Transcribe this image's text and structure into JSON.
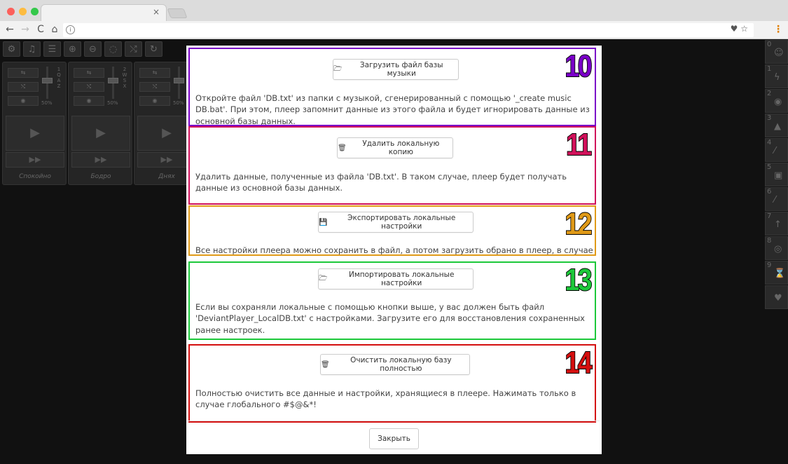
{
  "browser": {
    "traffic_lights": [
      "#fc605b",
      "#fdbc40",
      "#34c84a"
    ],
    "tab_close": "×",
    "nav_back": "←",
    "nav_forward": "→",
    "nav_reload": "C",
    "nav_home": "⌂",
    "info": "i",
    "omni_icons": "♥ ☆",
    "menu": "⋮"
  },
  "player": {
    "tools": [
      "gear-icon",
      "music-icon",
      "database-icon",
      "zoom-in-icon",
      "zoom-out-icon",
      "hide-icon",
      "shuffle-icon",
      "refresh-icon"
    ],
    "tool_glyphs": [
      "⚙",
      "♫",
      "☰",
      "⊕",
      "⊖",
      "◌",
      "⤭",
      "↻"
    ],
    "channels": [
      {
        "name": "Спокойно",
        "keys": "1 Q A Z",
        "volume": "50%"
      },
      {
        "name": "Бодро",
        "keys": "2 W S X",
        "volume": "50%"
      },
      {
        "name": "Днях",
        "keys": "",
        "volume": "50%"
      }
    ],
    "channel_btn_glyphs": [
      "⇆",
      "⤭",
      "◉"
    ],
    "play_glyph": "▶",
    "ff_glyph": "▶▶",
    "right_bar": [
      {
        "num": "0",
        "icon": "smile-icon",
        "glyph": "☺"
      },
      {
        "num": "1",
        "icon": "lightning-icon",
        "glyph": "ϟ"
      },
      {
        "num": "2",
        "icon": "eye-icon",
        "glyph": "◉"
      },
      {
        "num": "3",
        "icon": "warning-icon",
        "glyph": "▲"
      },
      {
        "num": "4",
        "icon": "magic-icon",
        "glyph": "⁄"
      },
      {
        "num": "5",
        "icon": "money-icon",
        "glyph": "▣"
      },
      {
        "num": "6",
        "icon": "feather-icon",
        "glyph": "⁄"
      },
      {
        "num": "7",
        "icon": "level-up-icon",
        "glyph": "↑"
      },
      {
        "num": "8",
        "icon": "record-icon",
        "glyph": "◎"
      },
      {
        "num": "9",
        "icon": "hourglass-icon",
        "glyph": "⌛"
      },
      {
        "num": "",
        "icon": "heartbeat-icon",
        "glyph": "♥"
      }
    ]
  },
  "modal": {
    "sections": [
      {
        "number": "10",
        "color": "#7a00c8",
        "button_label": "Загрузить файл базы музыки",
        "button_glyph": "🗁",
        "description": "Откройте файл 'DB.txt' из папки с музыкой, сгенерированный с помощью '_create music DB.bat'. При этом, плеер запомнит данные из этого файла и будет игнорировать данные из основной базы данных."
      },
      {
        "number": "11",
        "color": "#d0105a",
        "button_label": "Удалить локальную копию",
        "button_glyph": "🗑",
        "description": "Удалить данные, полученные из файла 'DB.txt'. В таком случае, плеер будет получать данные из основной базы данных."
      },
      {
        "number": "12",
        "color": "#e09a18",
        "button_label": "Экспортировать локальные настройки",
        "button_glyph": "💾",
        "description": "Все настройки плеера можно сохранить в файл, а потом загрузить обрано в плеер, в случае чего."
      },
      {
        "number": "13",
        "color": "#1cc83a",
        "button_label": "Импортировать локальные настройки",
        "button_glyph": "🗁",
        "description": "Если вы сохраняли локальные с помощью кнопки выше, у вас должен быть файл 'DeviantPlayer_LocalDB.txt' с настройками. Загрузите его для восстановления сохраненных ранее настроек."
      },
      {
        "number": "14",
        "color": "#d40f0f",
        "button_label": "Очистить локальную базу полностью",
        "button_glyph": "🗑",
        "description": "Полностью очистить все данные и настройки, хранящиеся в плеере. Нажимать только в случае глобального #$@&*!"
      }
    ],
    "close_label": "Закрыть"
  }
}
